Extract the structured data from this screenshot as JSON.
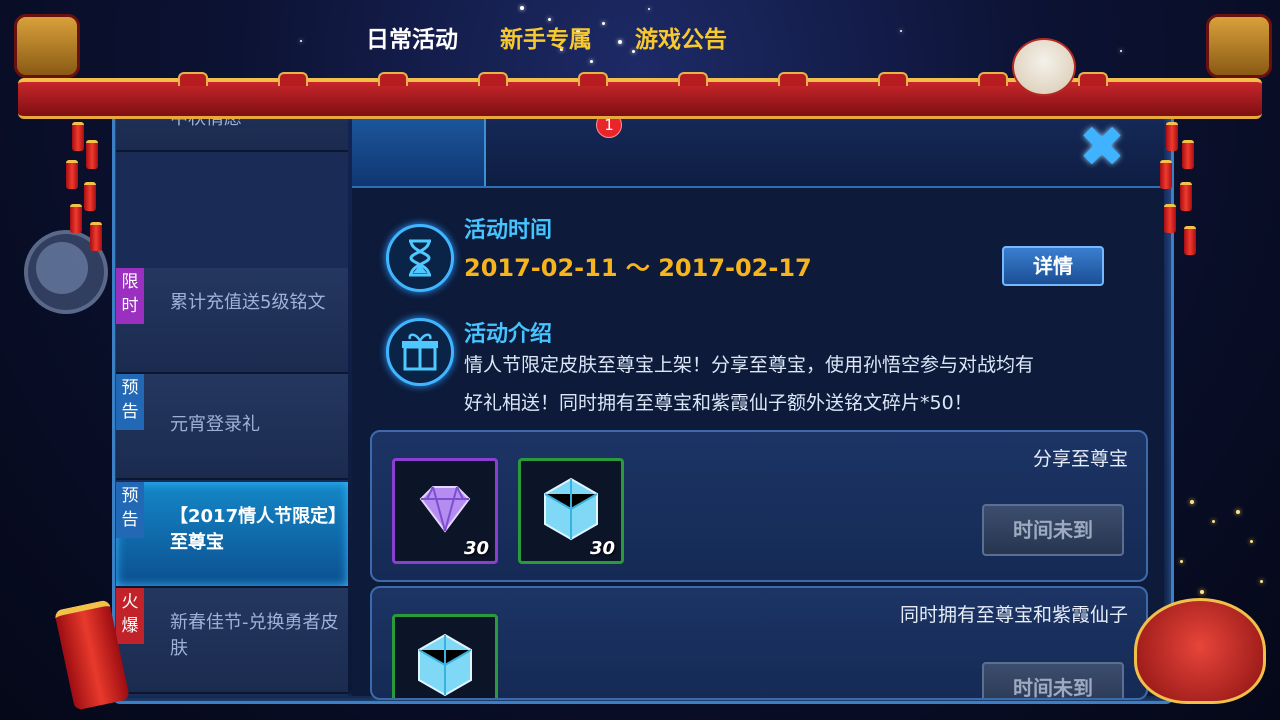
{
  "tabs": [
    {
      "label": "日常活动",
      "active": true
    },
    {
      "label": "新手专属",
      "active": false
    },
    {
      "label": "游戏公告",
      "active": false
    }
  ],
  "tab_badge": "1",
  "sidebar": {
    "items": [
      {
        "tag": "",
        "label": "中秋情愿"
      },
      {
        "tag": "限时",
        "label": "累计充值送5级铭文"
      },
      {
        "tag": "预告",
        "label": "元宵登录礼"
      },
      {
        "tag": "预告",
        "label": "【2017情人节限定】至尊宝",
        "active": true
      },
      {
        "tag": "火爆",
        "label": "新春佳节-兑换勇者皮肤"
      }
    ]
  },
  "event": {
    "time_title": "活动时间",
    "time_range": "2017-02-11 ～ 2017-02-17",
    "details_button": "详情",
    "intro_title": "活动介绍",
    "intro_line1": "情人节限定皮肤至尊宝上架！分享至尊宝，使用孙悟空参与对战均有",
    "intro_line2": "好礼相送！同时拥有至尊宝和紫霞仙子额外送铭文碎片*50！"
  },
  "rewards": [
    {
      "title": "分享至尊宝",
      "button": "时间未到",
      "items": [
        {
          "icon": "purple-diamond-icon",
          "qty": "30",
          "rarity": "purple"
        },
        {
          "icon": "blue-crystal-icon",
          "qty": "30",
          "rarity": "green"
        }
      ]
    },
    {
      "title": "同时拥有至尊宝和紫霞仙子",
      "button": "时间未到",
      "items": [
        {
          "icon": "blue-crystal-icon",
          "qty": "",
          "rarity": "green"
        }
      ]
    }
  ],
  "colors": {
    "accent_blue": "#45c4ff",
    "tab_gold": "#f7c830",
    "date_orange": "#f7b41c",
    "badge_red": "#e8252b"
  }
}
